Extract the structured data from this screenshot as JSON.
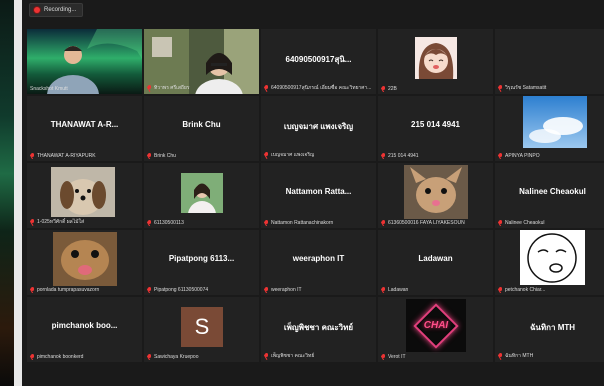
{
  "recording": {
    "label": "Recording..."
  },
  "colors": {
    "active_border": "#f2e44a",
    "muted_mic": "#e33",
    "tile_bg": "#222"
  },
  "tiles": [
    {
      "big": "",
      "label": "Snackshot Kmutt",
      "muted": false
    },
    {
      "big": "",
      "label": "ทิวาพร ศรีเสถียร",
      "muted": true
    },
    {
      "big": "64090500917สุนิ...",
      "label": "64090500917สุนิภรณ์ เอี่ยมซื่อ คณะวิทยาศา...",
      "muted": true
    },
    {
      "big": "",
      "label": "22B",
      "muted": true
    },
    {
      "big": "",
      "label": "วิรุณรัช Satamsatit",
      "muted": true
    },
    {
      "big": "THANAWAT A-R...",
      "label": "THANAWAT A-RIYAPURK",
      "muted": true
    },
    {
      "big": "Brink Chu",
      "label": "Brink Chu",
      "muted": true
    },
    {
      "big": "เบญจมาศ แพงเจริญ",
      "label": "เบญจมาศ แพงเจริญ",
      "muted": true
    },
    {
      "big": "215 014 4941",
      "label": "215 014 4941",
      "muted": true
    },
    {
      "big": "",
      "label": "APINYA PINPO",
      "muted": true
    },
    {
      "big": "",
      "label": "1-025ทวีศักดิ์ ผลไม้ใส่",
      "muted": true
    },
    {
      "big": "",
      "label": "61130500113",
      "muted": true
    },
    {
      "big": "Nattamon Ratta...",
      "label": "Nattamon Rattanachinakorn",
      "muted": true
    },
    {
      "big": "",
      "label": "61360500016 FAYA LIYAKESOUN",
      "muted": true
    },
    {
      "big": "Nalinee Cheaokul",
      "label": "Nalinee Cheaokul",
      "muted": true
    },
    {
      "big": "",
      "label": "pornlada tumprapasuvazorn",
      "muted": true
    },
    {
      "big": "Pipatpong 6113...",
      "label": "Pipatpong 61130500074",
      "muted": true
    },
    {
      "big": "weeraphon IT",
      "label": "weeraphon IT",
      "muted": true
    },
    {
      "big": "Ladawan",
      "label": "Ladawan",
      "muted": true
    },
    {
      "big": "",
      "label": "petchanok Chiar...",
      "muted": true
    },
    {
      "big": "pimchanok boo...",
      "label": "pimchanok boonkerd",
      "muted": true
    },
    {
      "big": "",
      "label": "Sawichaya Kruepoo",
      "muted": true
    },
    {
      "big": "เพ็ญพิชชา คณะวิทย์",
      "label": "เพ็ญพิชชา คณะวิทย์",
      "muted": true
    },
    {
      "big": "",
      "label": "Verot IT",
      "muted": true
    },
    {
      "big": "ฉันทิกา MTH",
      "label": "ฉันทิกา MTH",
      "muted": true
    }
  ],
  "avatar_s": {
    "letter": "S"
  },
  "chai": {
    "text": "CHAI"
  }
}
